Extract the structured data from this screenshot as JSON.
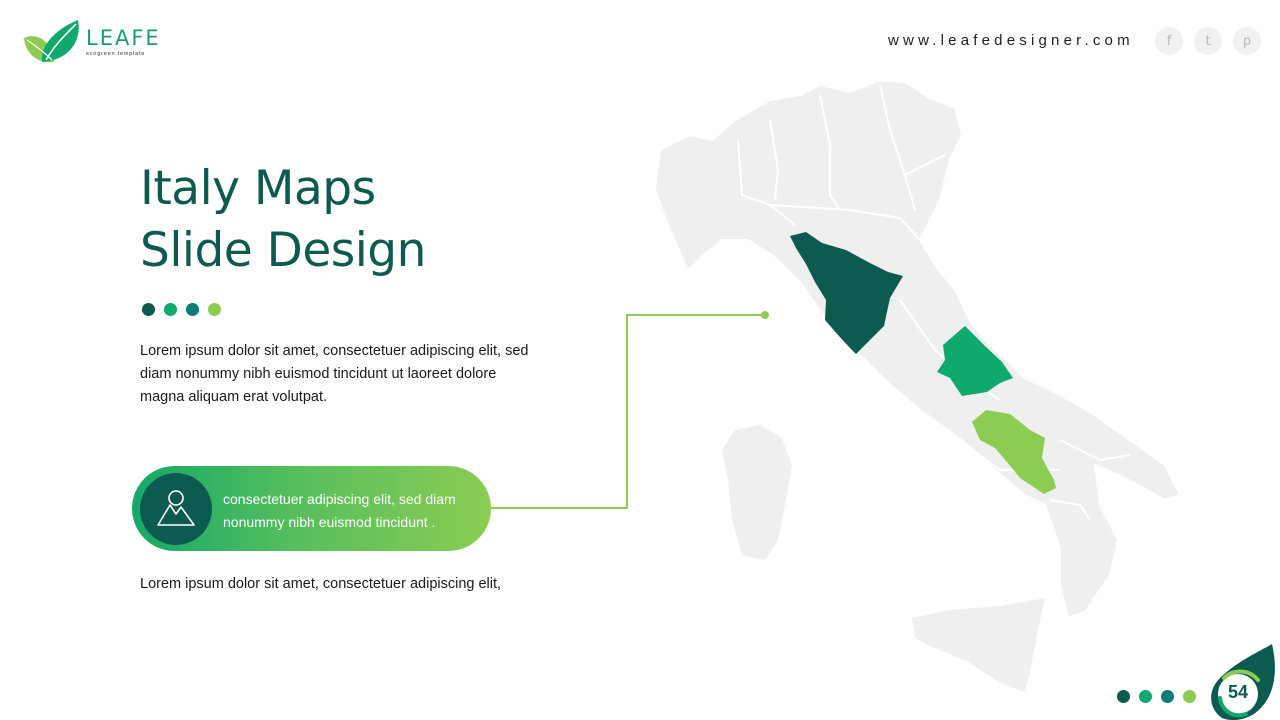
{
  "brand": {
    "name": "LEAFE",
    "tagline": "ecogreen template",
    "colors": {
      "dark_teal": "#0d5a50",
      "green": "#0fa96d",
      "teal": "#0c7c74",
      "lime": "#8ccc53",
      "map_gray": "#efefef"
    }
  },
  "header": {
    "website": "www.leafedesigner.com",
    "social": [
      {
        "icon": "facebook-icon",
        "glyph": "f"
      },
      {
        "icon": "twitter-icon",
        "glyph": "t"
      },
      {
        "icon": "pinterest-icon",
        "glyph": "p"
      }
    ]
  },
  "slide": {
    "title_line1": "Italy Maps",
    "title_line2": "Slide Design",
    "decor_dot_colors": [
      "#0d5a50",
      "#0fa96d",
      "#0c7c74",
      "#8ccc53"
    ],
    "paragraph1": "Lorem ipsum dolor sit amet, consectetuer adipiscing elit, sed diam nonummy  nibh euismod tincidunt ut laoreet dolore magna aliquam erat volutpat.",
    "callout": {
      "icon": "mountain-icon",
      "text": "consectetuer adipiscing elit, sed diam nonummy  nibh euismod tincidunt ."
    },
    "paragraph2": "Lorem ipsum dolor sit amet, consectetuer adipiscing elit,"
  },
  "map": {
    "country": "Italy",
    "highlighted_regions": [
      {
        "name": "Tuscany",
        "color": "#0d5a50"
      },
      {
        "name": "Abruzzo",
        "color": "#0fa96d"
      },
      {
        "name": "Campania",
        "color": "#8ccc53"
      }
    ],
    "connector_color": "#8ccc53"
  },
  "footer": {
    "page_number": "54",
    "dot_colors": [
      "#0d5a50",
      "#0fa96d",
      "#0c7c74",
      "#8ccc53"
    ]
  }
}
